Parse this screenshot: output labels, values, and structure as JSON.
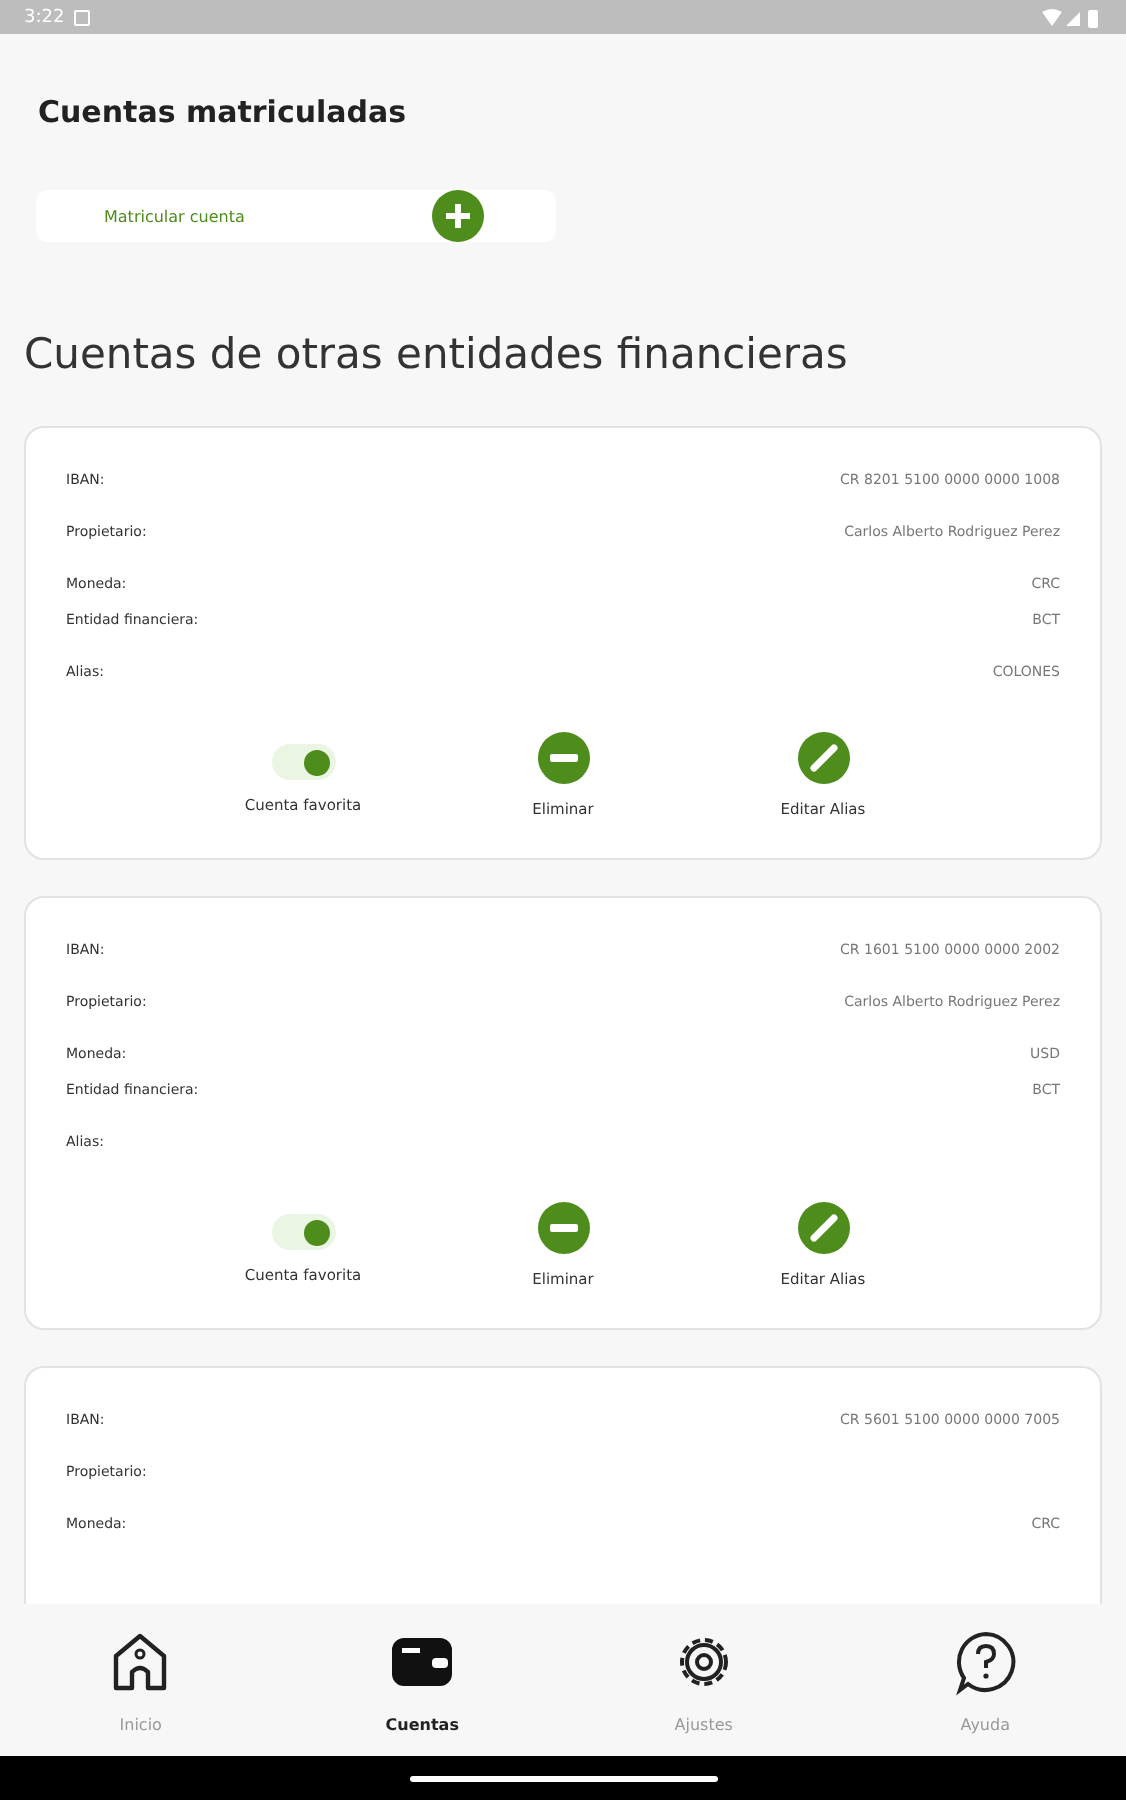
{
  "status_bar": {
    "time": "3:22"
  },
  "title": "Cuentas matriculadas",
  "add_account": {
    "label": "Matricular cuenta"
  },
  "section_title": "Cuentas de otras entidades financieras",
  "accounts": [
    {
      "fields": [
        {
          "label": "IBAN:",
          "value": "CR 8201 5100 0000 0000 1008"
        },
        {
          "label": "Propietario:",
          "value": "Carlos Alberto Rodriguez Perez"
        },
        {
          "label": "Moneda:",
          "value": "CRC"
        },
        {
          "label": "Entidad financiera:",
          "value": "BCT"
        },
        {
          "label": "Alias:",
          "value": "COLONES"
        }
      ],
      "favorite": {
        "label": "Cuenta favorita",
        "checked": true
      },
      "delete_label": "Eliminar",
      "edit_label": "Editar Alias"
    },
    {
      "fields": [
        {
          "label": "IBAN:",
          "value": "CR 1601 5100 0000 0000 2002"
        },
        {
          "label": "Propietario:",
          "value": "Carlos Alberto Rodriguez Perez"
        },
        {
          "label": "Moneda:",
          "value": "USD"
        },
        {
          "label": "Entidad financiera:",
          "value": "BCT"
        },
        {
          "label": "Alias:"
        }
      ],
      "favorite": {
        "label": "Cuenta favorita",
        "checked": true
      },
      "delete_label": "Eliminar",
      "edit_label": "Editar Alias"
    },
    {
      "fields": [
        {
          "label": "IBAN:",
          "value": "CR 5601 5100 0000 0000 7005"
        },
        {
          "label": "Propietario:"
        },
        {
          "label": "Moneda:",
          "value": "CRC"
        }
      ]
    }
  ],
  "nav": [
    {
      "kind": "home",
      "label": "Inicio",
      "selected": false
    },
    {
      "kind": "wallet",
      "label": "Cuentas",
      "selected": true
    },
    {
      "kind": "settings",
      "label": "Ajustes",
      "selected": false
    },
    {
      "kind": "help",
      "label": "Ayuda",
      "selected": false
    }
  ]
}
